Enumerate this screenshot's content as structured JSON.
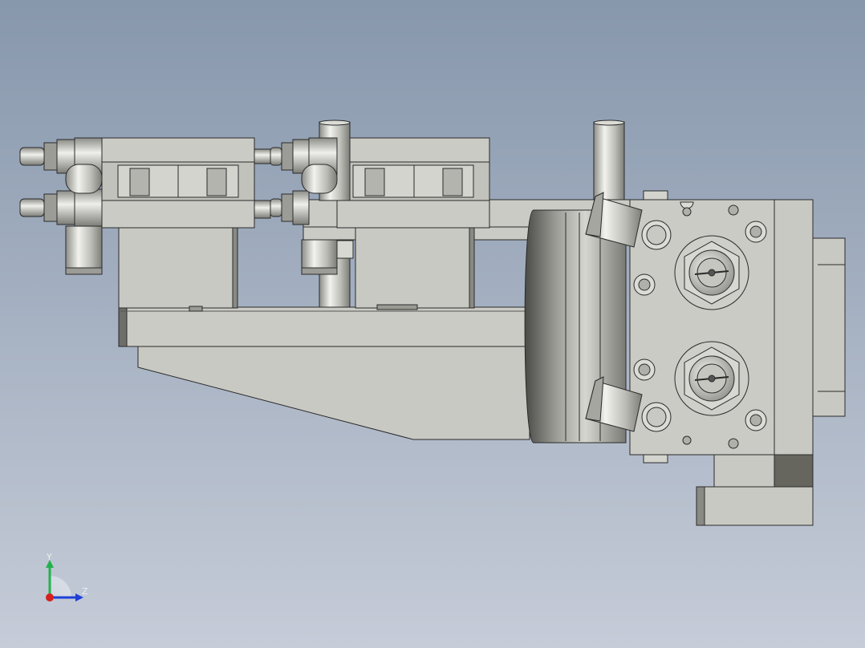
{
  "viewport": {
    "background_top": "#8797ac",
    "background_bottom": "#c6ccd8"
  },
  "axes": {
    "y_label": "Y",
    "z_label": "Z",
    "y_color": "#22b14c",
    "z_color": "#1f3fd6",
    "x_color": "#d62020"
  },
  "model": {
    "body_color": "#c9c9c3",
    "edge_color": "#2a2a2a",
    "shadow_color": "#6a6a62"
  }
}
